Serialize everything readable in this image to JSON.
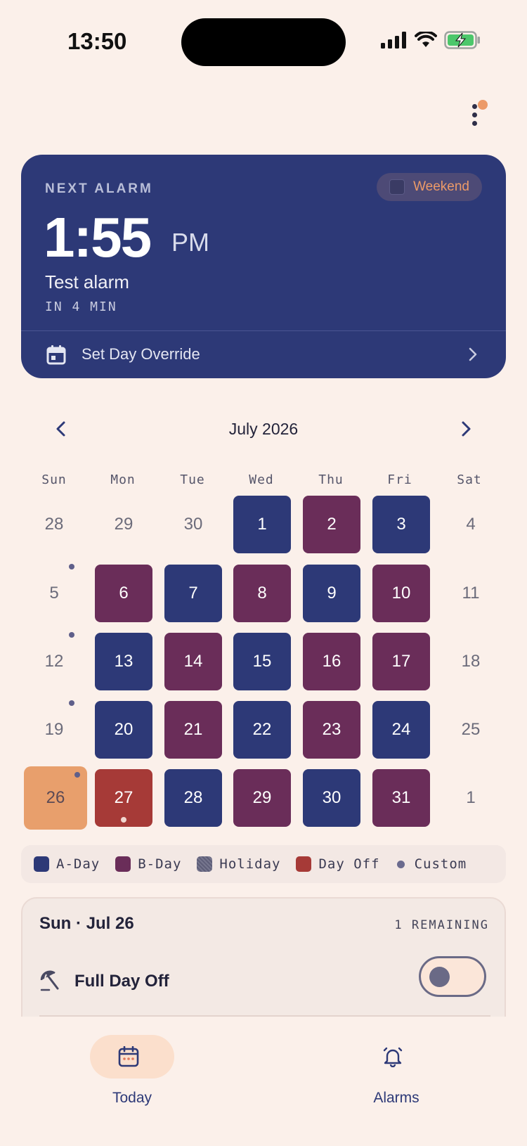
{
  "status_bar": {
    "time": "13:50"
  },
  "alarm": {
    "label": "NEXT ALARM",
    "badge": "Weekend",
    "time": "1:55",
    "ampm": "PM",
    "title": "Test alarm",
    "eta": "IN 4 MIN",
    "override_label": "Set Day Override"
  },
  "calendar": {
    "month_title": "July 2026",
    "weekdays": [
      "Sun",
      "Mon",
      "Tue",
      "Wed",
      "Thu",
      "Fri",
      "Sat"
    ],
    "weeks": [
      [
        {
          "d": "28",
          "t": "plain"
        },
        {
          "d": "29",
          "t": "plain"
        },
        {
          "d": "30",
          "t": "plain"
        },
        {
          "d": "1",
          "t": "aday"
        },
        {
          "d": "2",
          "t": "bday"
        },
        {
          "d": "3",
          "t": "aday"
        },
        {
          "d": "4",
          "t": "plain"
        }
      ],
      [
        {
          "d": "5",
          "t": "plain",
          "custom": true
        },
        {
          "d": "6",
          "t": "bday"
        },
        {
          "d": "7",
          "t": "aday"
        },
        {
          "d": "8",
          "t": "bday"
        },
        {
          "d": "9",
          "t": "aday"
        },
        {
          "d": "10",
          "t": "bday"
        },
        {
          "d": "11",
          "t": "plain"
        }
      ],
      [
        {
          "d": "12",
          "t": "plain",
          "custom": true
        },
        {
          "d": "13",
          "t": "aday"
        },
        {
          "d": "14",
          "t": "bday"
        },
        {
          "d": "15",
          "t": "aday"
        },
        {
          "d": "16",
          "t": "bday"
        },
        {
          "d": "17",
          "t": "bday"
        },
        {
          "d": "18",
          "t": "plain"
        }
      ],
      [
        {
          "d": "19",
          "t": "plain",
          "custom": true
        },
        {
          "d": "20",
          "t": "aday"
        },
        {
          "d": "21",
          "t": "bday"
        },
        {
          "d": "22",
          "t": "aday"
        },
        {
          "d": "23",
          "t": "bday"
        },
        {
          "d": "24",
          "t": "aday"
        },
        {
          "d": "25",
          "t": "plain"
        }
      ],
      [
        {
          "d": "26",
          "t": "today",
          "custom": true
        },
        {
          "d": "27",
          "t": "dayoff",
          "alarm_dot": true
        },
        {
          "d": "28",
          "t": "aday"
        },
        {
          "d": "29",
          "t": "bday"
        },
        {
          "d": "30",
          "t": "aday"
        },
        {
          "d": "31",
          "t": "bday"
        },
        {
          "d": "1",
          "t": "plain"
        }
      ]
    ]
  },
  "legend": [
    {
      "label": "A-Day",
      "color": "#2D3977"
    },
    {
      "label": "B-Day",
      "color": "#6A2D59"
    },
    {
      "label": "Holiday",
      "color": "#5E5E78"
    },
    {
      "label": "Day Off",
      "color": "#A63A37"
    },
    {
      "label": "Custom",
      "color": "#6B6B8E"
    }
  ],
  "day_panel": {
    "title": "Sun · Jul 26",
    "remaining": "1 REMAINING",
    "full_day_off_label": "Full Day Off",
    "full_day_off_enabled": false
  },
  "nav": {
    "today_label": "Today",
    "alarms_label": "Alarms",
    "active": "today"
  },
  "colors": {
    "background": "#FBF0EA",
    "a_day": "#2D3977",
    "b_day": "#6A2D59",
    "day_off": "#A63A37",
    "today": "#E89F6C",
    "accent": "#EC9A68"
  }
}
